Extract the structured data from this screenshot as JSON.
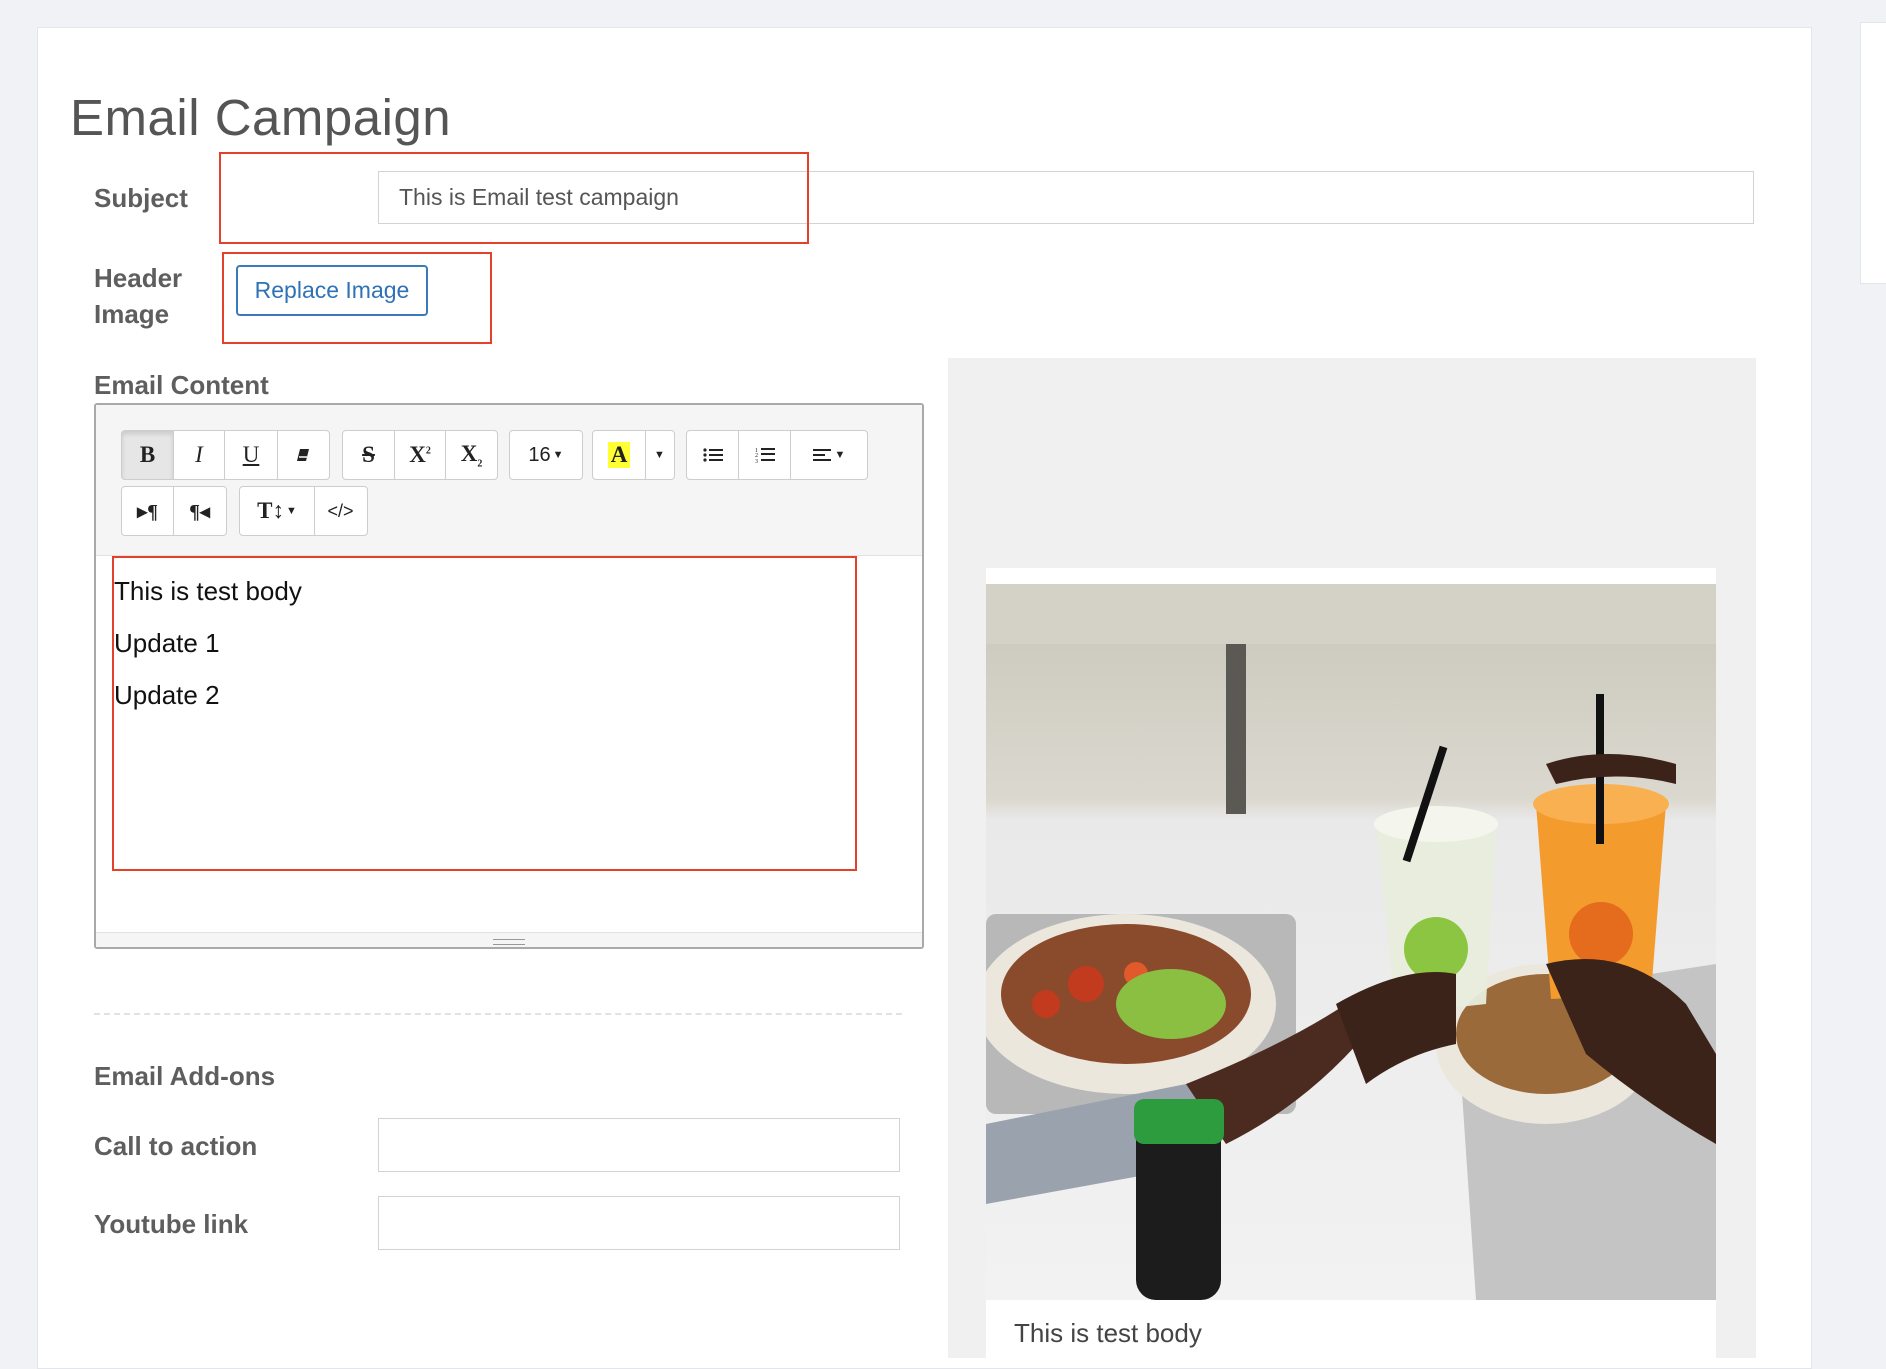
{
  "page": {
    "title": "Email Campaign"
  },
  "subject": {
    "label": "Subject",
    "value": "This is Email test campaign"
  },
  "header_image": {
    "label_line1": "Header",
    "label_line2": "Image",
    "button_label": "Replace Image"
  },
  "email_content": {
    "label": "Email Content",
    "toolbar": {
      "bold": "B",
      "italic": "I",
      "underline": "U",
      "strikethrough": "S",
      "superscript": "X",
      "subscript": "X",
      "font_size": "16",
      "font_color": "A",
      "highlight_color": "#ffff33"
    },
    "body_lines": [
      "This is test body",
      "Update 1",
      "Update 2"
    ]
  },
  "addons": {
    "heading": "Email Add-ons",
    "call_to_action": {
      "label": "Call to action",
      "value": ""
    },
    "youtube_link": {
      "label": "Youtube link",
      "value": ""
    }
  },
  "preview": {
    "body_text": "This is test body"
  }
}
